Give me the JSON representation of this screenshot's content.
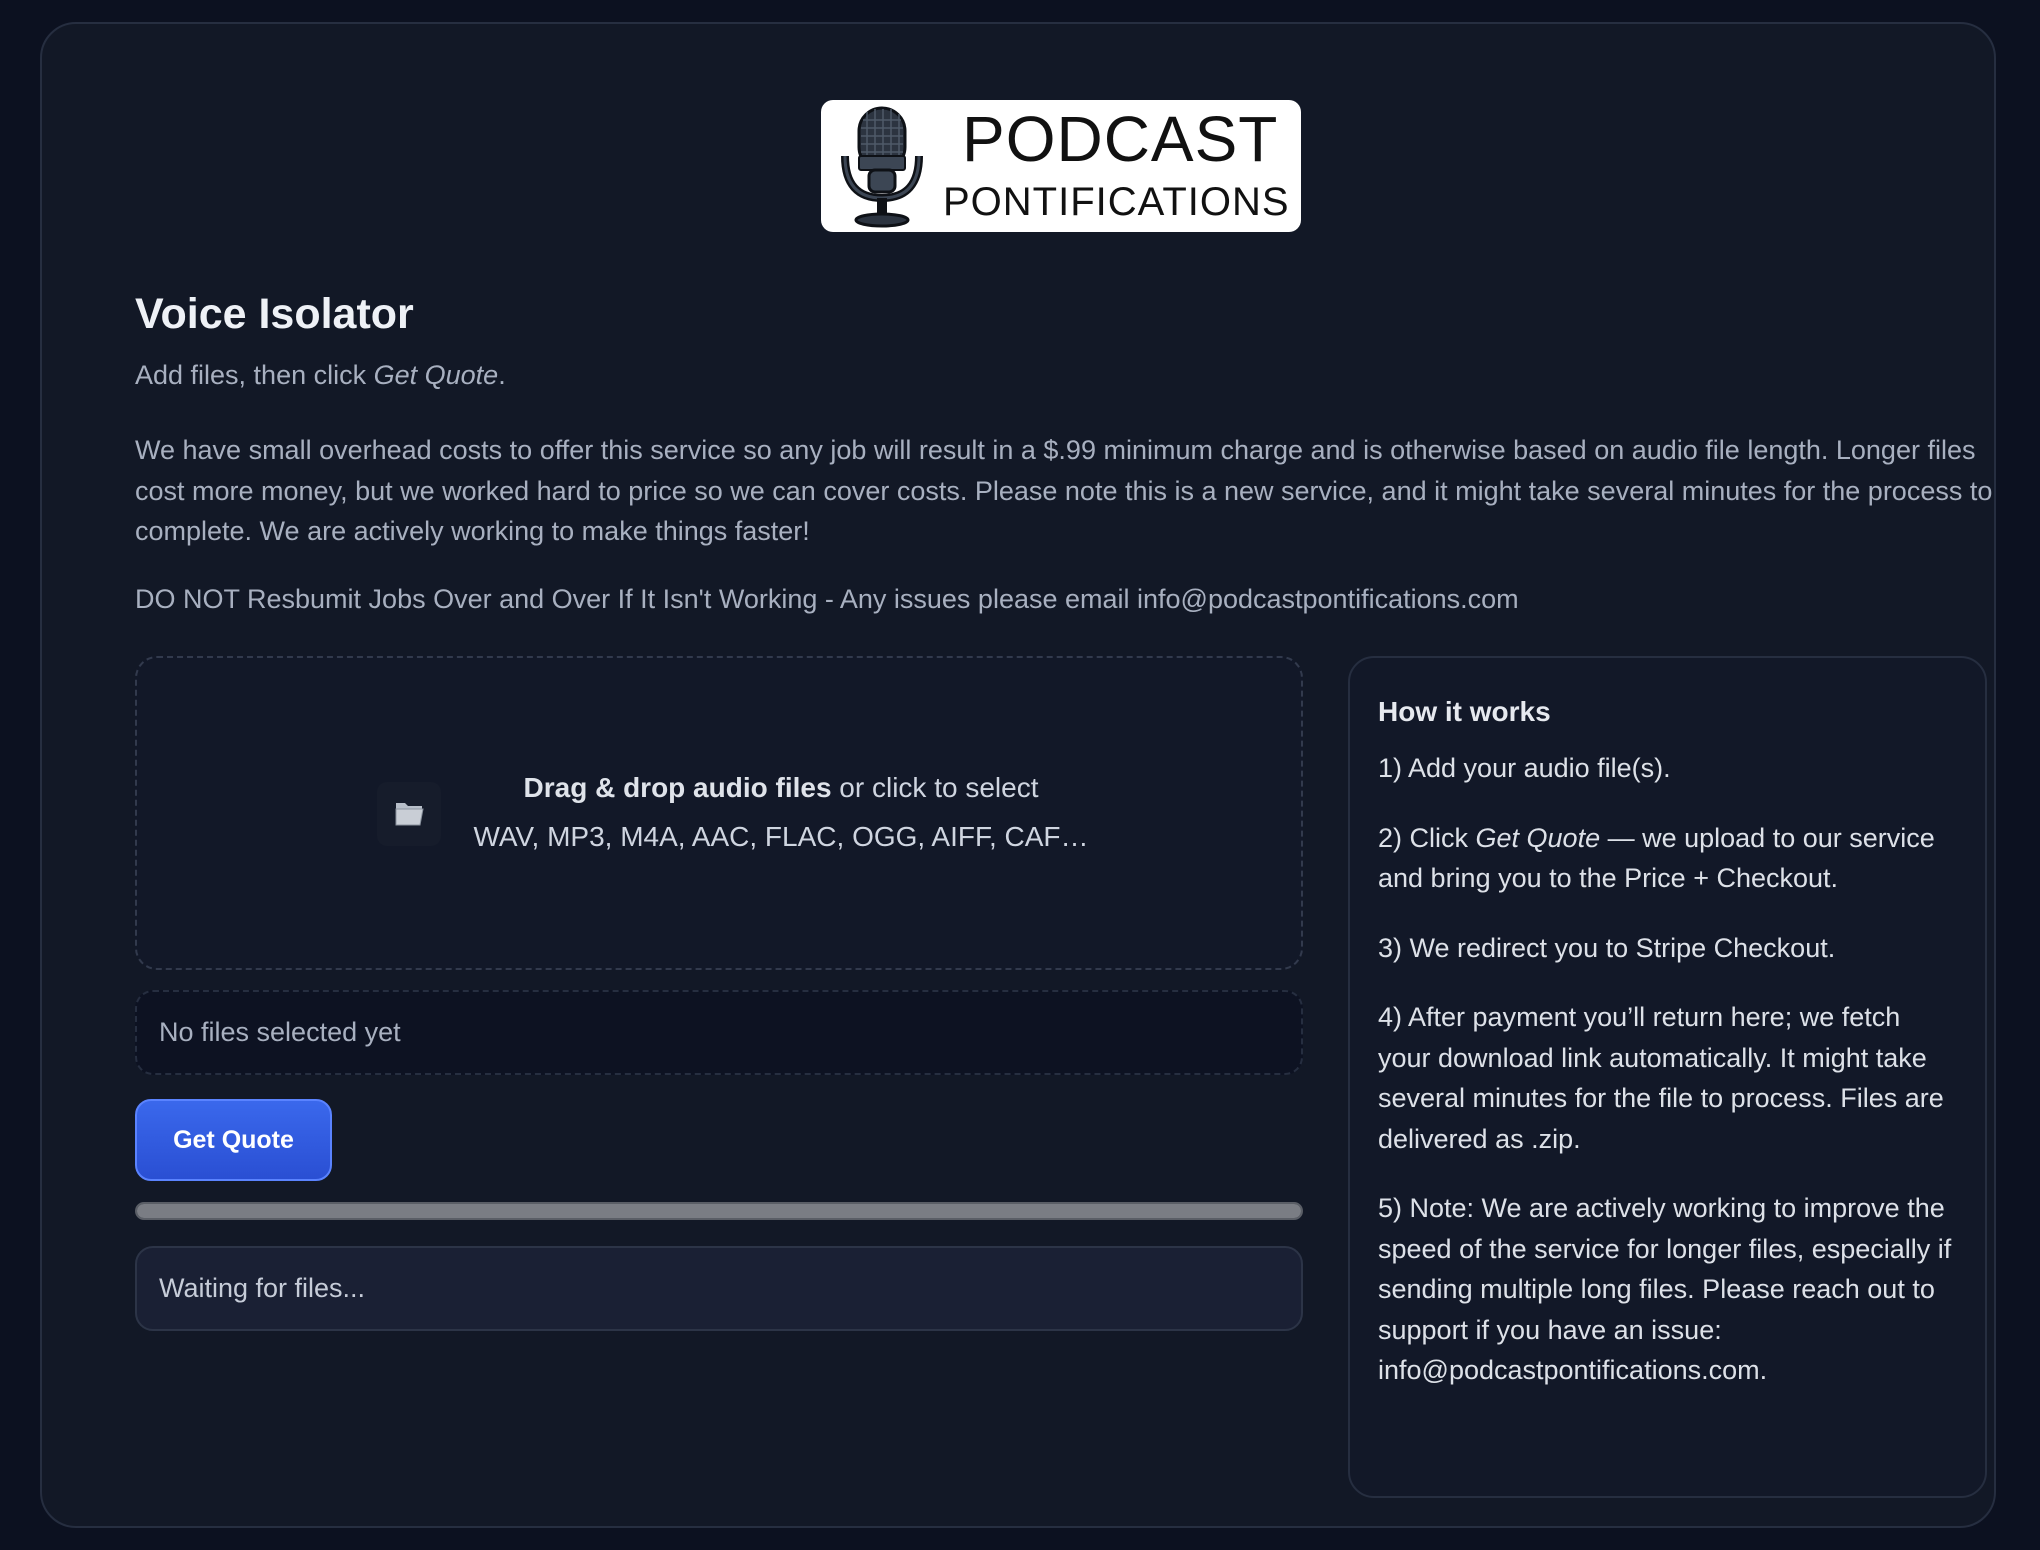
{
  "logo": {
    "line1": "PODCAST",
    "line2": "PONTIFICATIONS"
  },
  "page": {
    "title": "Voice Isolator",
    "subtitle_prefix": "Add files, then click ",
    "subtitle_emphasis": "Get Quote",
    "subtitle_suffix": ".",
    "notice": "We have small overhead costs to offer this service so any job will result in a $.99 minimum charge and is otherwise based on audio file length. Longer files cost more money, but we worked hard to price so we can cover costs. Please note this is a new service, and it might take several minutes for the process to complete. We are actively working to make things faster!",
    "warning": "DO NOT Resbumit Jobs Over and Over If It Isn't Working - Any issues please email info@podcastpontifications.com"
  },
  "dropzone": {
    "icon": "folder-icon",
    "title_bold": "Drag & drop audio files",
    "title_rest": " or click to select",
    "formats": "WAV, MP3, M4A, AAC, FLAC, OGG, AIFF, CAF…"
  },
  "file_list": {
    "empty_text": "No files selected yet"
  },
  "actions": {
    "quote_label": "Get Quote"
  },
  "progress": {
    "value": 0
  },
  "status": {
    "text": "Waiting for files..."
  },
  "how_it_works": {
    "heading": "How it works",
    "step1": "1) Add your audio file(s).",
    "step2_prefix": "2) Click ",
    "step2_emphasis": "Get Quote",
    "step2_suffix": " — we upload to our service and bring you to the Price + Checkout.",
    "step3": "3) We redirect you to Stripe Checkout.",
    "step4": "4) After payment you’ll return here; we fetch your download link automatically. It might take several minutes for the file to process. Files are delivered as .zip.",
    "step5": "5) Note: We are actively working to improve the speed of the service for longer files, especially if sending multiple long files. Please reach out to support if you have an issue: info@podcastpontifications.com."
  },
  "colors": {
    "background": "#0c1120",
    "card": "#121826",
    "accent": "#2f5be0",
    "text_muted": "#a8b0c0"
  }
}
